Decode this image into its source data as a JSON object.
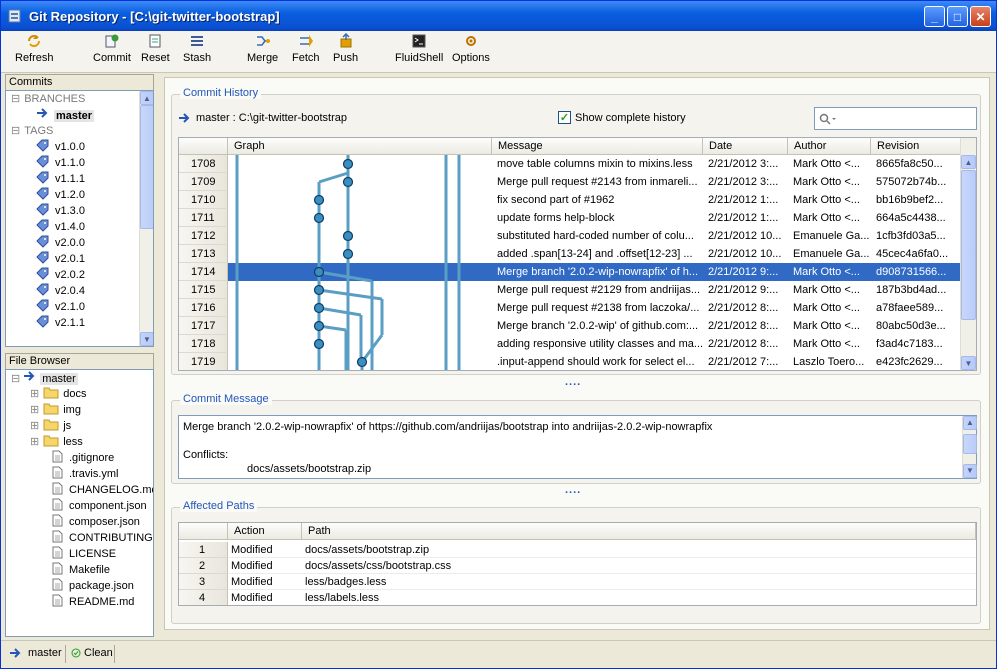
{
  "window": {
    "title": "Git Repository - [C:\\git-twitter-bootstrap]"
  },
  "toolbar": [
    {
      "label": "Refresh",
      "icon": "refresh-icon"
    },
    {
      "label": "Commit",
      "icon": "commit-icon"
    },
    {
      "label": "Reset",
      "icon": "reset-icon"
    },
    {
      "label": "Stash",
      "icon": "stash-icon"
    },
    {
      "label": "Merge",
      "icon": "merge-icon"
    },
    {
      "label": "Fetch",
      "icon": "fetch-icon"
    },
    {
      "label": "Push",
      "icon": "push-icon"
    },
    {
      "label": "FluidShell",
      "icon": "fluidshell-icon"
    },
    {
      "label": "Options",
      "icon": "options-icon"
    }
  ],
  "commits_panel": {
    "title": "Commits",
    "branches_label": "BRANCHES",
    "branch": "master",
    "tags_label": "TAGS",
    "tags": [
      "v1.0.0",
      "v1.1.0",
      "v1.1.1",
      "v1.2.0",
      "v1.3.0",
      "v1.4.0",
      "v2.0.0",
      "v2.0.1",
      "v2.0.2",
      "v2.0.4",
      "v2.1.0",
      "v2.1.1"
    ]
  },
  "file_browser": {
    "title": "File Browser",
    "root": "master",
    "folders": [
      "docs",
      "img",
      "js",
      "less"
    ],
    "files": [
      ".gitignore",
      ".travis.yml",
      "CHANGELOG.md",
      "component.json",
      "composer.json",
      "CONTRIBUTING.md",
      "LICENSE",
      "Makefile",
      "package.json",
      "README.md"
    ]
  },
  "history": {
    "title": "Commit History",
    "branch_path": "master : C:\\git-twitter-bootstrap",
    "show_complete_label": "Show complete history",
    "show_complete_checked": true,
    "search_placeholder": "",
    "columns": [
      "Graph",
      "Message",
      "Date",
      "Author",
      "Revision"
    ],
    "rows": [
      {
        "n": "1708",
        "msg": "move table columns mixin to mixins.less",
        "date": "2/21/2012 3:...",
        "author": "Mark Otto <...",
        "rev": "8665fa8c50..."
      },
      {
        "n": "1709",
        "msg": "Merge pull request #2143 from inmareli...",
        "date": "2/21/2012 3:...",
        "author": "Mark Otto <...",
        "rev": "575072b74b..."
      },
      {
        "n": "1710",
        "msg": "fix second part of #1962",
        "date": "2/21/2012 1:...",
        "author": "Mark Otto <...",
        "rev": "bb16b9bef2..."
      },
      {
        "n": "1711",
        "msg": "update forms help-block",
        "date": "2/21/2012 1:...",
        "author": "Mark Otto <...",
        "rev": "664a5c4438..."
      },
      {
        "n": "1712",
        "msg": "substituted hard-coded number of colu...",
        "date": "2/21/2012 10...",
        "author": "Emanuele Ga...",
        "rev": "1cfb3fd03a5..."
      },
      {
        "n": "1713",
        "msg": "added .span[13-24] and .offset[12-23] ...",
        "date": "2/21/2012 10...",
        "author": "Emanuele Ga...",
        "rev": "45cec4a6fa0..."
      },
      {
        "n": "1714",
        "msg": "Merge branch '2.0.2-wip-nowrapfix' of h...",
        "date": "2/21/2012 9:...",
        "author": "Mark Otto <...",
        "rev": "d908731566..."
      },
      {
        "n": "1715",
        "msg": "Merge pull request #2129 from andriijas...",
        "date": "2/21/2012 9:...",
        "author": "Mark Otto <...",
        "rev": "187b3bd4ad..."
      },
      {
        "n": "1716",
        "msg": "Merge pull request #2138 from laczoka/...",
        "date": "2/21/2012 8:...",
        "author": "Mark Otto <...",
        "rev": "a78faee589..."
      },
      {
        "n": "1717",
        "msg": "Merge branch '2.0.2-wip' of github.com:...",
        "date": "2/21/2012 8:...",
        "author": "Mark Otto <...",
        "rev": "80abc50d3e..."
      },
      {
        "n": "1718",
        "msg": "adding responsive utility classes and ma...",
        "date": "2/21/2012 8:...",
        "author": "Mark Otto <...",
        "rev": "f3ad4c7183..."
      },
      {
        "n": "1719",
        "msg": ".input-append should work for select el...",
        "date": "2/21/2012 7:...",
        "author": "Laszlo Toero...",
        "rev": "e423fc2629..."
      }
    ],
    "selected_index": 6
  },
  "commit_message": {
    "title": "Commit Message",
    "line1": "Merge branch '2.0.2-wip-nowrapfix' of https://github.com/andriijas/bootstrap into andriijas-2.0.2-wip-nowrapfix",
    "line2": "Conflicts:",
    "line3": "docs/assets/bootstrap.zip"
  },
  "affected_paths": {
    "title": "Affected Paths",
    "columns": [
      "Action",
      "Path"
    ],
    "rows": [
      {
        "n": "1",
        "action": "Modified",
        "path": "docs/assets/bootstrap.zip"
      },
      {
        "n": "2",
        "action": "Modified",
        "path": "docs/assets/css/bootstrap.css"
      },
      {
        "n": "3",
        "action": "Modified",
        "path": "less/badges.less"
      },
      {
        "n": "4",
        "action": "Modified",
        "path": "less/labels.less"
      }
    ]
  },
  "splitter": "....",
  "status": {
    "branch": "master",
    "state": "Clean"
  }
}
